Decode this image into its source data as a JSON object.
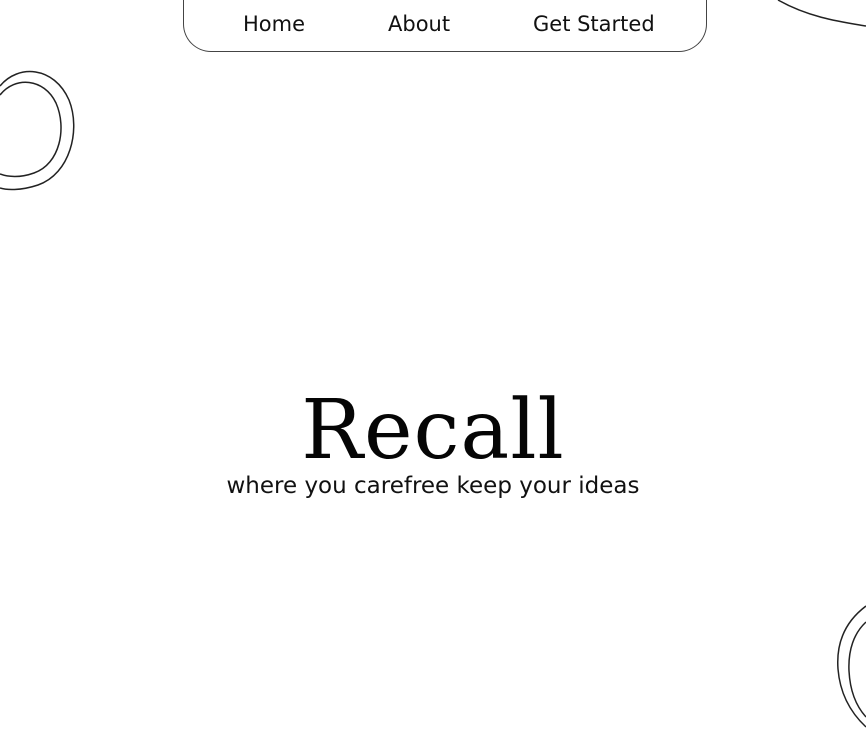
{
  "nav": {
    "items": [
      {
        "label": "Home"
      },
      {
        "label": "About"
      },
      {
        "label": "Get Started"
      }
    ]
  },
  "hero": {
    "title": "Recall",
    "subtitle": "where you carefree keep your ideas"
  },
  "decor": {
    "stroke": "#222222",
    "background": "#ffffff"
  }
}
